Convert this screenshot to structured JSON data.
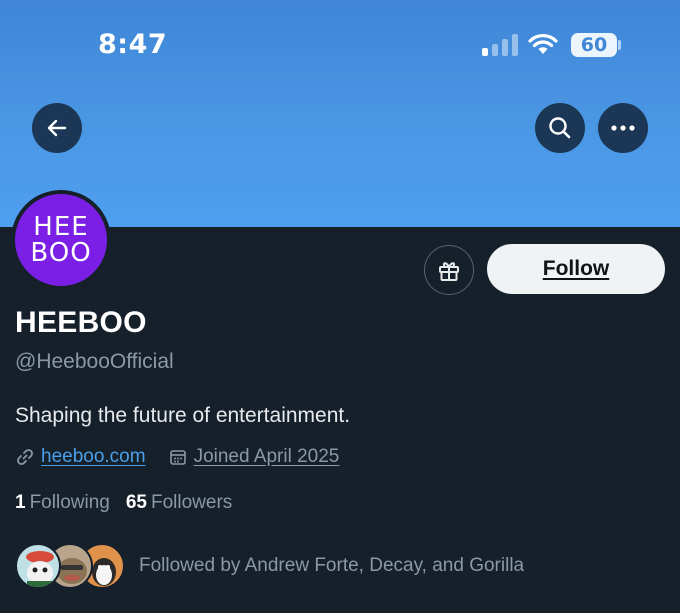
{
  "status_bar": {
    "time": "8:47",
    "battery": "60",
    "signal_bars": 4,
    "signal_active": 1
  },
  "banner": {
    "color": "#4a97e4"
  },
  "avatar": {
    "line1": "HEE",
    "line2": "BOO",
    "color": "#7b1fe6"
  },
  "profile": {
    "display_name": "HEEBOO",
    "handle": "@HeebooOfficial",
    "bio": "Shaping the future of entertainment.",
    "website": "heeboo.com",
    "joined": "Joined April 2025"
  },
  "actions": {
    "follow_label": "Follow"
  },
  "stats": {
    "following_count": "1",
    "following_label": "Following",
    "followers_count": "65",
    "followers_label": "Followers"
  },
  "followed_by": {
    "text": "Followed by Andrew Forte, Decay, and Gorilla"
  },
  "icons": {
    "back": "arrow-left-icon",
    "search": "search-icon",
    "more": "more-icon",
    "gift": "gift-icon",
    "link": "link-icon",
    "calendar": "calendar-icon"
  },
  "colors": {
    "background": "#15202b",
    "accent_link": "#4a9fe8",
    "muted_text": "#8b98a5"
  }
}
